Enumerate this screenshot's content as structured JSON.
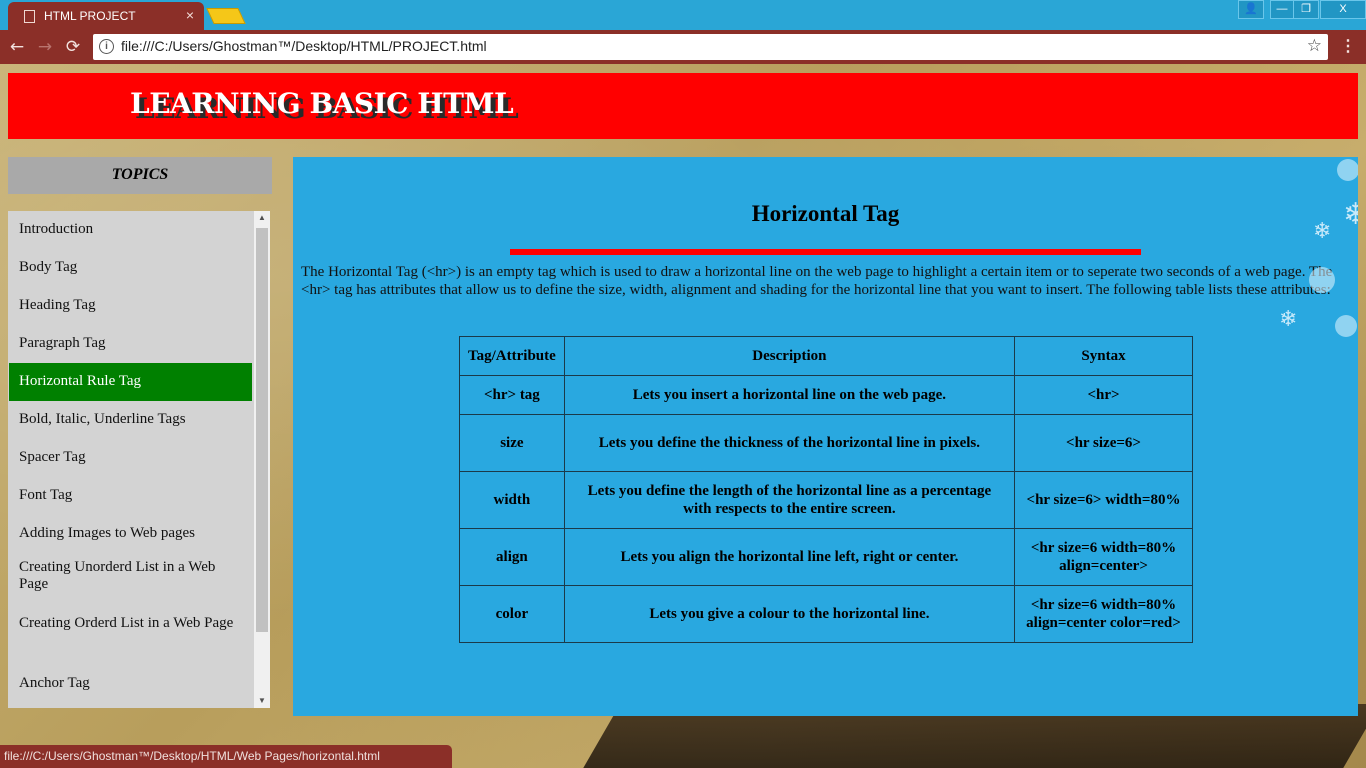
{
  "browser": {
    "tab_title": "HTML PROJECT",
    "tab_close": "×",
    "url": "file:///C:/Users/Ghostman™/Desktop/HTML/PROJECT.html",
    "status_url": "file:///C:/Users/Ghostman™/Desktop/HTML/Web Pages/horizontal.html",
    "window_controls": {
      "user": "👤",
      "minimize": "—",
      "maximize": "❐",
      "close": "X"
    },
    "nav": {
      "back": "←",
      "forward": "→",
      "reload": "⟳",
      "info": "i",
      "star": "☆",
      "menu": "⋮"
    }
  },
  "header": {
    "title": "LEARNING BASIC HTML"
  },
  "sidebar": {
    "topics_label": "TOPICS",
    "items": [
      {
        "label": "Introduction"
      },
      {
        "label": "Body Tag"
      },
      {
        "label": "Heading Tag"
      },
      {
        "label": "Paragraph Tag"
      },
      {
        "label": "Horizontal Rule Tag",
        "active": true
      },
      {
        "label": "Bold, Italic, Underline Tags"
      },
      {
        "label": "Spacer Tag"
      },
      {
        "label": "Font Tag"
      },
      {
        "label": "Adding Images to Web pages"
      },
      {
        "label": "Creating Unorderd List in a Web Page"
      },
      {
        "label": "Creating Orderd List in a Web Page"
      },
      {
        "label": "Anchor Tag"
      }
    ]
  },
  "main": {
    "heading": "Horizontal Tag",
    "intro": "The Horizontal Tag (<hr>) is an empty tag which is used to draw a horizontal line on the web page to highlight a certain item or to seperate two seconds of a web page. The <hr> tag has attributes that allow us to define the size, width, alignment and shading for the horizontal line that you want to insert. The following table lists these attributes:",
    "table": {
      "headers": [
        "Tag/Attribute",
        "Description",
        "Syntax"
      ],
      "rows": [
        [
          "<hr> tag",
          "Lets you insert a horizontal line on the web page.",
          "<hr>"
        ],
        [
          "size",
          "Lets you define the thickness of the horizontal line in pixels.",
          "<hr size=6>"
        ],
        [
          "width",
          "Lets you define the length of the horizontal line as a percentage with respects to the entire screen.",
          "<hr size=6> width=80%"
        ],
        [
          "align",
          "Lets you align the horizontal line left, right or center.",
          "<hr size=6 width=80% align=center>"
        ],
        [
          "color",
          "Lets you give a colour to the horizontal line.",
          "<hr size=6 width=80% align=center color=red>"
        ]
      ]
    }
  },
  "colors": {
    "header_bg": "#ff0000",
    "content_bg": "#29a8e0",
    "active_item_bg": "#008000",
    "chrome_bg": "#8b2f28",
    "titlebar_bg": "#2aa6d6"
  }
}
